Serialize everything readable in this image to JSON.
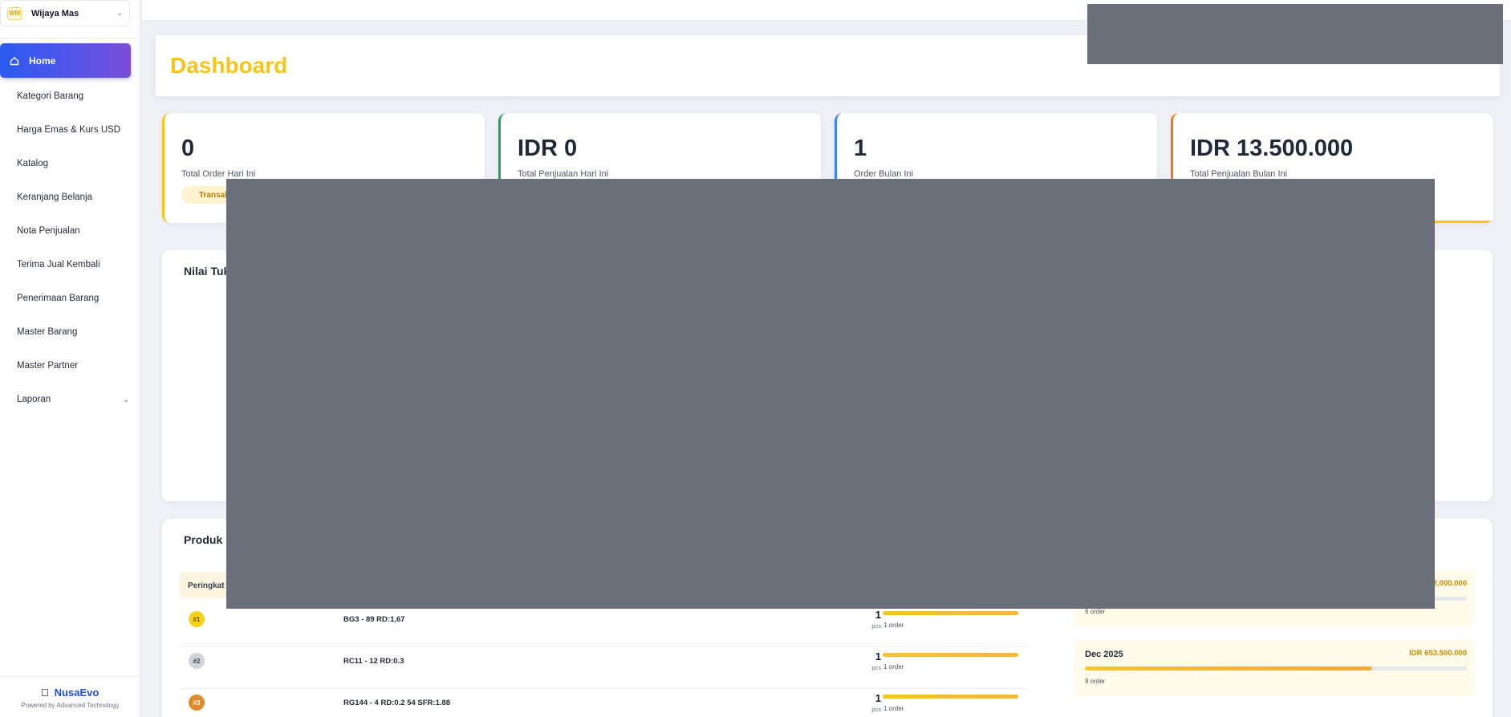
{
  "org": {
    "logo_text": "WM",
    "name": "Wijaya Mas"
  },
  "nav": {
    "home": "Home",
    "items": [
      {
        "label": "Kategori Barang"
      },
      {
        "label": "Harga Emas & Kurs USD"
      },
      {
        "label": "Katalog"
      },
      {
        "label": "Keranjang Belanja"
      },
      {
        "label": "Nota Penjualan"
      },
      {
        "label": "Terima Jual Kembali"
      },
      {
        "label": "Penerimaan Barang"
      },
      {
        "label": "Master Barang"
      },
      {
        "label": "Master Partner"
      },
      {
        "label": "Laporan"
      }
    ]
  },
  "footer": {
    "brand": "NusaEvo",
    "powered": "Powered by Advanced Technology"
  },
  "page": {
    "title": "Dashboard"
  },
  "stats": [
    {
      "value": "0",
      "label": "Total Order Hari Ini",
      "pill": "Transak",
      "accent": "#f5c518"
    },
    {
      "value": "IDR 0",
      "label": "Total Penjualan Hari Ini",
      "accent": "#22a55a"
    },
    {
      "value": "1",
      "label": "Order Bulan Ini",
      "accent": "#3b82f6"
    },
    {
      "value": "IDR 13.500.000",
      "label": "Total Penjualan Bulan Ini",
      "accent": "#f97316"
    }
  ],
  "panels": {
    "nilai_title": "Nilai Tuk",
    "produk_title": "Produk"
  },
  "table": {
    "header_rank": "Peringkat",
    "rows": [
      {
        "rank": "#1",
        "product": "BG3 - 89 RD:1,67",
        "qty": "1",
        "unit": "pcs",
        "orders": "1 order",
        "rank_bg": "#f5d21a",
        "rank_fg": "#6b4e00",
        "bar_level": 1.0
      },
      {
        "rank": "#2",
        "product": "RC11 - 12 RD:0.3",
        "qty": "1",
        "unit": "pcs",
        "orders": "1 order",
        "rank_bg": "#cfd3da",
        "rank_fg": "#374151",
        "bar_level": 1.0
      },
      {
        "rank": "#3",
        "product": "RG144 - 4 RD:0.2 54 SFR:1.88",
        "qty": "1",
        "unit": "pcs",
        "orders": "1 order",
        "rank_bg": "#e08a2b",
        "rank_fg": "#ffffff",
        "bar_level": 1.0
      }
    ]
  },
  "months": [
    {
      "name": "",
      "total": "2.000.000",
      "orders": "6 order",
      "fill": 0.5
    },
    {
      "name": "Dec 2025",
      "total": "IDR 653.500.000",
      "orders": "9 order",
      "fill": 0.75
    }
  ]
}
